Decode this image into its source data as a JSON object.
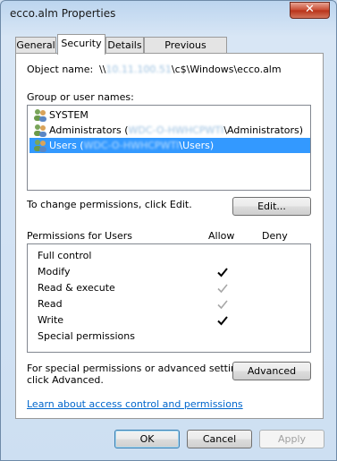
{
  "window": {
    "title": "ecco.alm Properties",
    "close_label": "✕"
  },
  "tabs": [
    {
      "label": "General",
      "active": false
    },
    {
      "label": "Security",
      "active": true
    },
    {
      "label": "Details",
      "active": false
    },
    {
      "label": "Previous Versions",
      "active": false
    }
  ],
  "object": {
    "label": "Object name:",
    "prefix": "\\\\",
    "host_redacted": "10.11.100.51",
    "path": "\\c$\\Windows\\ecco.alm"
  },
  "groups": {
    "label": "Group or user names:",
    "items": [
      {
        "name": "SYSTEM",
        "pre": "",
        "redacted": "",
        "post": "",
        "icon": "user-group-icon",
        "selected": false
      },
      {
        "name": "Administrators (",
        "pre": "",
        "redacted": "WDC-O-HWHCPWTI",
        "post": "\\Administrators)",
        "icon": "user-group-icon",
        "selected": false
      },
      {
        "name": "Users (",
        "pre": "",
        "redacted": "WDC-O-HWHCPWTI",
        "post": "\\Users)",
        "icon": "user-group-icon",
        "selected": true
      }
    ]
  },
  "edit": {
    "prompt": "To change permissions, click Edit.",
    "button": "Edit..."
  },
  "permissions": {
    "title": "Permissions for Users",
    "allow_label": "Allow",
    "deny_label": "Deny",
    "rows": [
      {
        "name": "Full control",
        "allow": "none"
      },
      {
        "name": "Modify",
        "allow": "checked"
      },
      {
        "name": "Read & execute",
        "allow": "inherited"
      },
      {
        "name": "Read",
        "allow": "inherited"
      },
      {
        "name": "Write",
        "allow": "checked"
      },
      {
        "name": "Special permissions",
        "allow": "none"
      }
    ]
  },
  "advanced": {
    "line1": "For special permissions or advanced settings,",
    "line2": "click Advanced.",
    "button": "Advanced"
  },
  "learn_link": "Learn about access control and permissions",
  "footer": {
    "ok": "OK",
    "cancel": "Cancel",
    "apply": "Apply"
  },
  "colors": {
    "selection": "#3399ff",
    "link": "#0066cc",
    "close": "#c7492f"
  }
}
